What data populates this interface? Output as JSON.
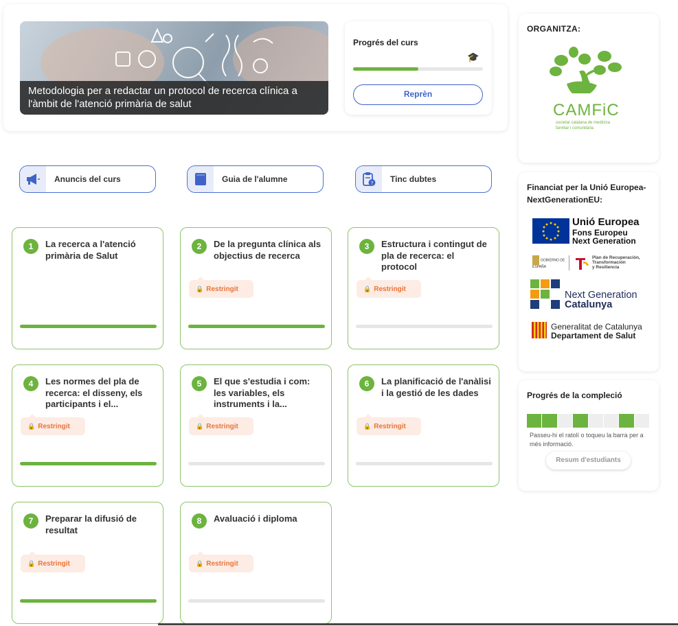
{
  "course": {
    "title": "Metodologia per a redactar un protocol de recerca clínica a l'àmbit de l'atenció primària de salut"
  },
  "progress_card": {
    "title": "Progrés del curs",
    "progress_fraction": 0.5,
    "resume_label": "Reprèn"
  },
  "quick_links": [
    {
      "label": "Anuncis del curs",
      "icon": "megaphone-icon"
    },
    {
      "label": "Guia de l'alumne",
      "icon": "book-icon"
    },
    {
      "label": "Tinc dubtes",
      "icon": "clipboard-question-icon"
    }
  ],
  "restricted_label": "Restringit",
  "modules": [
    {
      "number": "1",
      "title": "La recerca a l'atenció primària de Salut",
      "restricted": false,
      "progress": 1.0
    },
    {
      "number": "2",
      "title": "De la pregunta clínica als objectius de recerca",
      "restricted": true,
      "progress": 1.0
    },
    {
      "number": "3",
      "title": "Estructura i contingut de pla de recerca: el protocol",
      "restricted": true,
      "progress": 0.0
    },
    {
      "number": "4",
      "title": "Les normes del pla de recerca: el disseny, els participants i el...",
      "restricted": true,
      "progress": 1.0
    },
    {
      "number": "5",
      "title": "El que s'estudia i com: les variables, els instruments i la...",
      "restricted": true,
      "progress": 0.0
    },
    {
      "number": "6",
      "title": "La planificació de l'anàlisi i la gestió de les dades",
      "restricted": true,
      "progress": 0.0
    },
    {
      "number": "7",
      "title": "Preparar la difusió de resultat",
      "restricted": true,
      "progress": 1.0
    },
    {
      "number": "8",
      "title": "Avaluació i diploma",
      "restricted": true,
      "progress": 0.0
    }
  ],
  "organizer": {
    "title": "ORGANITZA:",
    "logo_name": "CAMFiC",
    "logo_subtitle_1": "societat catalana de medicina",
    "logo_subtitle_2": "familiar i comunitària"
  },
  "funding": {
    "title": "Financiat per la Unió Europea-NextGenerationEU:",
    "eu_line1": "Unió Europea",
    "eu_line2": "Fons Europeu",
    "eu_line3": "Next Generation",
    "gov_small": "GOBIERNO DE ESPAÑA",
    "plan_line1": "Plan de Recuperación,",
    "plan_line2": "Transformación",
    "plan_line3": "y Resiliencia",
    "ngc_line1": "Next Generation",
    "ngc_line2": "Catalunya",
    "gen_line1": "Generalitat de Catalunya",
    "gen_line2": "Departament de Salut"
  },
  "completion": {
    "title": "Progrés de la compleció",
    "segments": [
      true,
      true,
      false,
      true,
      false,
      false,
      true,
      false
    ],
    "help_text": "Passeu-hi el ratolí o toqueu la barra per a més informació.",
    "summary_label": "Resum d'estudiants"
  },
  "colors": {
    "accent_green": "#6db33f",
    "accent_blue": "#3f63c9",
    "restricted_orange": "#e8743b"
  }
}
